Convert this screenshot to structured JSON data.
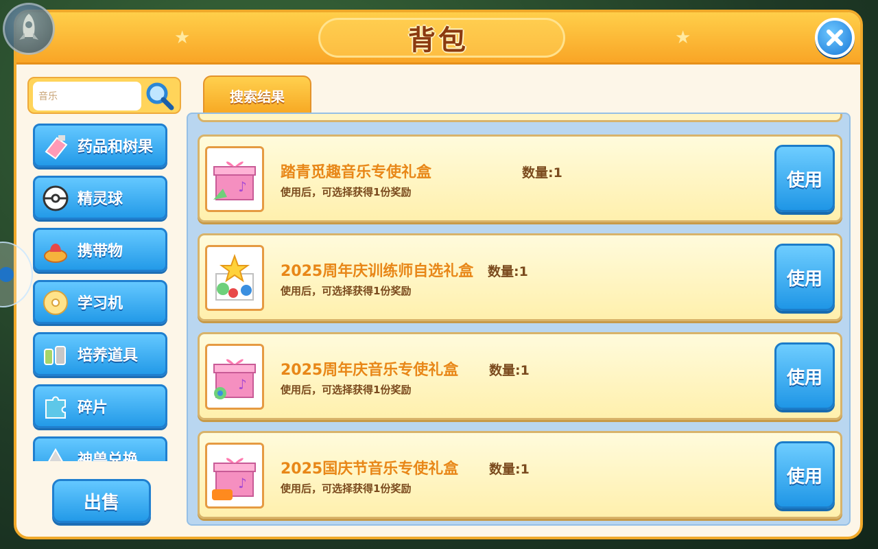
{
  "header": {
    "title": "背包"
  },
  "search": {
    "value": "音乐"
  },
  "tab": {
    "label": "搜索结果"
  },
  "categories": [
    {
      "label": "药品和树果",
      "icon": "potion-icon"
    },
    {
      "label": "精灵球",
      "icon": "pokeball-icon"
    },
    {
      "label": "携带物",
      "icon": "held-item-icon"
    },
    {
      "label": "学习机",
      "icon": "disc-icon"
    },
    {
      "label": "培养道具",
      "icon": "training-item-icon"
    },
    {
      "label": "碎片",
      "icon": "puzzle-piece-icon"
    },
    {
      "label": "神兽兑换",
      "icon": "legendary-icon"
    }
  ],
  "sell_button": "出售",
  "items": [
    {
      "name": "踏青觅趣音乐专使礼盒",
      "qty": "数量:1",
      "desc": "使用后，可选择获得1份奖励",
      "use": "使用"
    },
    {
      "name": "2025周年庆训练师自选礼盒",
      "qty": "数量:1",
      "desc": "使用后，可选择获得1份奖励",
      "use": "使用"
    },
    {
      "name": "2025周年庆音乐专使礼盒",
      "qty": "数量:1",
      "desc": "使用后，可选择获得1份奖励",
      "use": "使用"
    },
    {
      "name": "2025国庆节音乐专使礼盒",
      "qty": "数量:1",
      "desc": "使用后，可选择获得1份奖励",
      "use": "使用"
    }
  ],
  "colors": {
    "header_orange": "#f9a526",
    "button_blue": "#239ae8",
    "item_name_orange": "#e88718",
    "text_brown": "#7a4a1d"
  }
}
